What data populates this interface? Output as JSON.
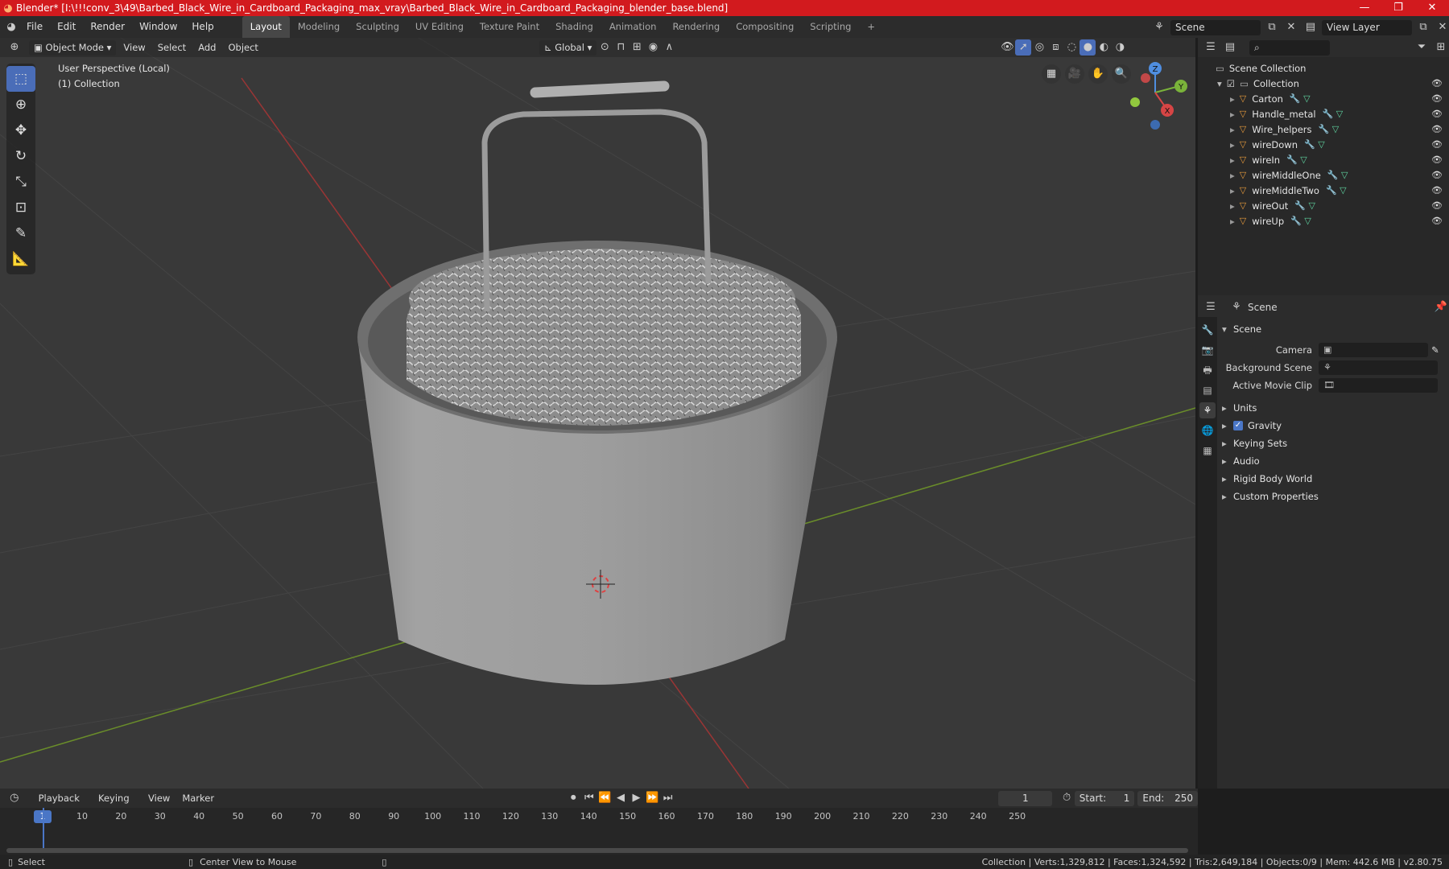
{
  "titlebar": {
    "title": "Blender* [I:\\!!!conv_3\\49\\Barbed_Black_Wire_in_Cardboard_Packaging_max_vray\\Barbed_Black_Wire_in_Cardboard_Packaging_blender_base.blend]",
    "minimize": "—",
    "maximize": "❐",
    "close": "✕"
  },
  "menus": [
    "File",
    "Edit",
    "Render",
    "Window",
    "Help"
  ],
  "workspaces": [
    "Layout",
    "Modeling",
    "Sculpting",
    "UV Editing",
    "Texture Paint",
    "Shading",
    "Animation",
    "Rendering",
    "Compositing",
    "Scripting"
  ],
  "workspace_add": "+",
  "scene_field": "Scene",
  "viewlayer_field": "View Layer",
  "viewport": {
    "mode": "Object Mode",
    "menus": [
      "View",
      "Select",
      "Add",
      "Object"
    ],
    "orientation": "Global",
    "info_line1": "User Perspective (Local)",
    "info_line2": "(1) Collection"
  },
  "gizmo": {
    "z": "Z",
    "y": "Y",
    "x": "X"
  },
  "outliner": {
    "root": "Scene Collection",
    "collection": "Collection",
    "items": [
      "Carton",
      "Handle_metal",
      "Wire_helpers",
      "wireDown",
      "wireIn",
      "wireMiddleOne",
      "wireMiddleTwo",
      "wireOut",
      "wireUp"
    ]
  },
  "properties": {
    "context": "Scene",
    "section": "Scene",
    "fields": [
      {
        "label": "Camera"
      },
      {
        "label": "Background Scene"
      },
      {
        "label": "Active Movie Clip"
      }
    ],
    "subsections": [
      "Units",
      "Gravity",
      "Keying Sets",
      "Audio",
      "Rigid Body World",
      "Custom Properties"
    ]
  },
  "timeline": {
    "menus": [
      "Playback",
      "Keying",
      "View",
      "Marker"
    ],
    "current_frame": "1",
    "start_label": "Start:",
    "start": "1",
    "end_label": "End:",
    "end": "250",
    "ticks": [
      "1",
      "10",
      "20",
      "30",
      "40",
      "50",
      "60",
      "70",
      "80",
      "90",
      "100",
      "110",
      "120",
      "130",
      "140",
      "150",
      "160",
      "170",
      "180",
      "190",
      "200",
      "210",
      "220",
      "230",
      "240",
      "250"
    ]
  },
  "statusbar": {
    "left_action": "Select",
    "mid_action": "Center View to Mouse",
    "stats": "Collection | Verts:1,329,812 | Faces:1,324,592 | Tris:2,649,184 | Objects:0/9 | Mem: 442.6 MB | v2.80.75"
  }
}
